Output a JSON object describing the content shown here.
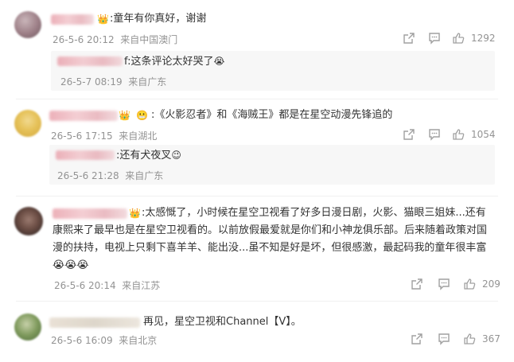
{
  "comments": [
    {
      "badge_icon": "crown-icon",
      "text": ":童年有你真好，谢谢",
      "date": "26-5-6 20:12",
      "location": "来自中国澳门",
      "likes": "1292",
      "reply": {
        "text": "f:这条评论太好哭了",
        "emoji": "😭",
        "date": "26-5-7 08:19",
        "location": "来自广东"
      }
    },
    {
      "badge_icon": "crown-icon",
      "text": ":《火影忍者》和《海贼王》都是在星空动漫先锋追的",
      "date": "26-5-6 17:15",
      "location": "来自湖北",
      "likes": "1054",
      "reply": {
        "text": ":还有犬夜叉",
        "emoji": "😉",
        "date": "26-5-6 21:28",
        "location": "来自广东"
      }
    },
    {
      "badge_icon": "crown-icon",
      "text_line1": ":太感慨了，小时候在星空卫视看了好多日漫日剧，火影、猫眼三姐妹...还有",
      "text_line2": "康熙来了最早也是在星空卫视看的。以前放假最爱就是你们和小神龙俱乐部。后来随着政策对国",
      "text_line3": "漫的扶持，电视上只剩下喜羊羊、能出没...虽不知是好是坏，但很感激，最起码我的童年很丰富",
      "emojis": "😭😭😭",
      "date": "26-5-6 20:14",
      "location": "来自江苏",
      "likes": "209"
    },
    {
      "text": "再见，星空卫视和Channel【V】。",
      "date": "26-5-6 16:09",
      "location": "来自北京",
      "likes": "367"
    }
  ],
  "icons": {
    "share": "share-icon",
    "comment": "comment-icon",
    "like": "like-icon"
  },
  "colors": {
    "meta": "#939393",
    "text": "#333333",
    "name_blur": "#e9a3ad",
    "reply_bg": "#f7f7f7"
  }
}
